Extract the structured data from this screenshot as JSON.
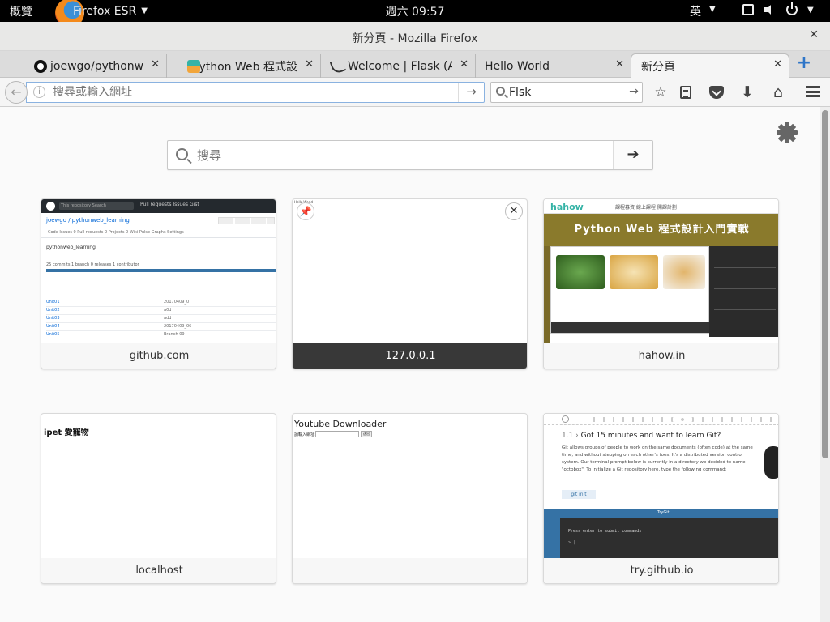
{
  "topbar": {
    "activities": "概覽",
    "app_name": "Firefox ESR",
    "clock": "週六 09:57",
    "input_method": "英"
  },
  "window": {
    "title": "新分頁 - Mozilla Firefox"
  },
  "tabs": [
    {
      "title": "joewgo/pythonweb_learning",
      "favicon": "github-icon"
    },
    {
      "title": "Python Web 程式設計入門實戰",
      "favicon": "hahow-icon"
    },
    {
      "title": "Welcome | Flask (A Python Microframework)",
      "favicon": "flask-icon"
    },
    {
      "title": "Hello World",
      "favicon": ""
    },
    {
      "title": "新分頁",
      "favicon": "",
      "active": true
    }
  ],
  "navbar": {
    "url_placeholder": "搜尋或輸入網址",
    "url_value": "",
    "search_value": "Flsk"
  },
  "newtab": {
    "search_placeholder": "搜尋",
    "tiles": [
      {
        "label": "github.com",
        "kind": "github"
      },
      {
        "label": "127.0.0.1",
        "kind": "blank",
        "hovered": true
      },
      {
        "label": "hahow.in",
        "kind": "hahow"
      },
      {
        "label": "localhost",
        "kind": "localhost"
      },
      {
        "label": "",
        "kind": "youtube"
      },
      {
        "label": "try.github.io",
        "kind": "trygit"
      }
    ]
  },
  "thumbs": {
    "github": {
      "search_hint": "This repository   Search",
      "nav": "Pull requests   Issues   Gist",
      "repo": "joewgo / pythonweb_learning",
      "tabs": "Code   Issues 0   Pull requests 0   Projects 0   Wiki   Pulse   Graphs   Settings",
      "desc": "pythonweb_learning",
      "stats": "25 commits          1 branch          0 releases          1 contributor",
      "rows": [
        {
          "name": "Unit01",
          "date": "20170409_0"
        },
        {
          "name": "Unit02",
          "date": "a0d"
        },
        {
          "name": "Unit03",
          "date": "add"
        },
        {
          "name": "Unit04",
          "date": "20170409_06"
        },
        {
          "name": "Unit05",
          "date": "Branch 09"
        }
      ]
    },
    "blank": {
      "tiny_text": "Hello World"
    },
    "hahow": {
      "brand": "hahow",
      "menu": "課程募資   線上課程   開課計劃",
      "banner": "Python Web 程式設計入門實戰"
    },
    "localhost": {
      "title": "ipet 愛寵物"
    },
    "youtube": {
      "title": "Youtube Downloader",
      "label": "請輸入網址：",
      "button": "送出"
    },
    "trygit": {
      "number": "1.1 ›",
      "heading": "Got 15 minutes and want to learn Git?",
      "body": "Git allows groups of people to work on the same documents (often code) at the same time, and without stepping on each other's toes. It's a distributed version control system. Our terminal prompt below is currently in a directory we decided to name \"octobox\". To initialize a Git repository here, type the following command:",
      "command": "git init",
      "terminal_title": "TryGit",
      "terminal_line1": "Press enter to submit commands",
      "terminal_line2": "> |"
    }
  }
}
